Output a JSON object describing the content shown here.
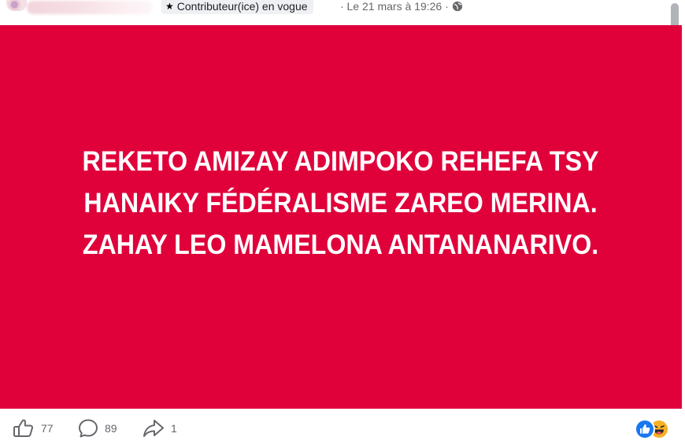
{
  "header": {
    "badge_label": "Contributeur(ice) en vogue",
    "date": "· Le 21 mars à 19:26 ·"
  },
  "post": {
    "background": "#e0013b",
    "line1": "REKETO AMIZAY ADIMPOKO REHEFA TSY",
    "line2": "HANAIKY FÉDÉRALISME ZAREO MERINA.",
    "line3": "ZAHAY LEO MAMELONA ANTANANARIVO."
  },
  "actions": {
    "likes": "77",
    "comments": "89",
    "shares": "1"
  },
  "icons": {
    "badge": "star-icon",
    "audience": "globe-icon",
    "like": "thumb-up-icon",
    "comment": "comment-bubble-icon",
    "share": "share-arrow-icon",
    "reactions": [
      "like-reaction-icon",
      "haha-reaction-icon"
    ]
  }
}
